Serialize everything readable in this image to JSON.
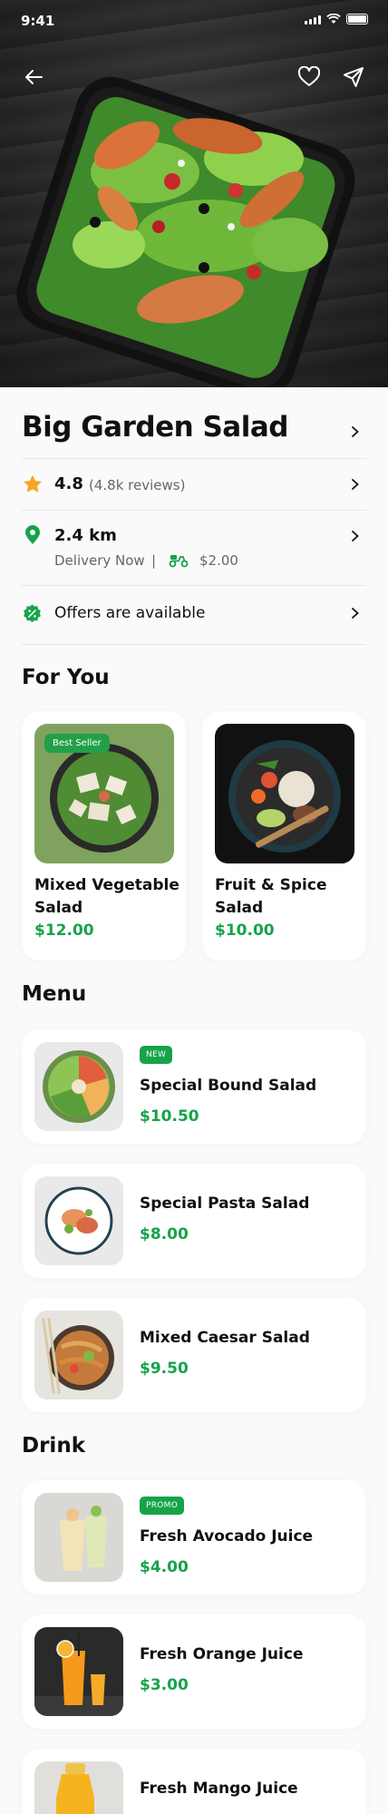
{
  "status_bar": {
    "time": "9:41"
  },
  "product": {
    "title": "Big Garden Salad",
    "rating": "4.8",
    "reviews": "(4.8k reviews)",
    "distance": "2.4 km",
    "delivery_status": "Delivery Now",
    "separator": "|",
    "delivery_fee": "$2.00",
    "offers": "Offers are available"
  },
  "for_you": {
    "title": "For You",
    "items": [
      {
        "name": "Mixed Vegetable Salad",
        "price": "$12.00",
        "badge": "Best Seller"
      },
      {
        "name": "Fruit & Spice Salad",
        "price": "$10.00"
      }
    ]
  },
  "menu": {
    "title": "Menu",
    "items": [
      {
        "name": "Special Bound Salad",
        "price": "$10.50",
        "tag": "NEW"
      },
      {
        "name": "Special Pasta Salad",
        "price": "$8.00"
      },
      {
        "name": "Mixed Caesar Salad",
        "price": "$9.50"
      }
    ]
  },
  "drink": {
    "title": "Drink",
    "items": [
      {
        "name": "Fresh Avocado Juice",
        "price": "$4.00",
        "tag": "PROMO"
      },
      {
        "name": "Fresh Orange Juice",
        "price": "$3.00"
      },
      {
        "name": "Fresh Mango Juice",
        "price": ""
      }
    ]
  },
  "colors": {
    "accent": "#16a34a",
    "star": "#f5a623",
    "background": "#fafafa"
  }
}
